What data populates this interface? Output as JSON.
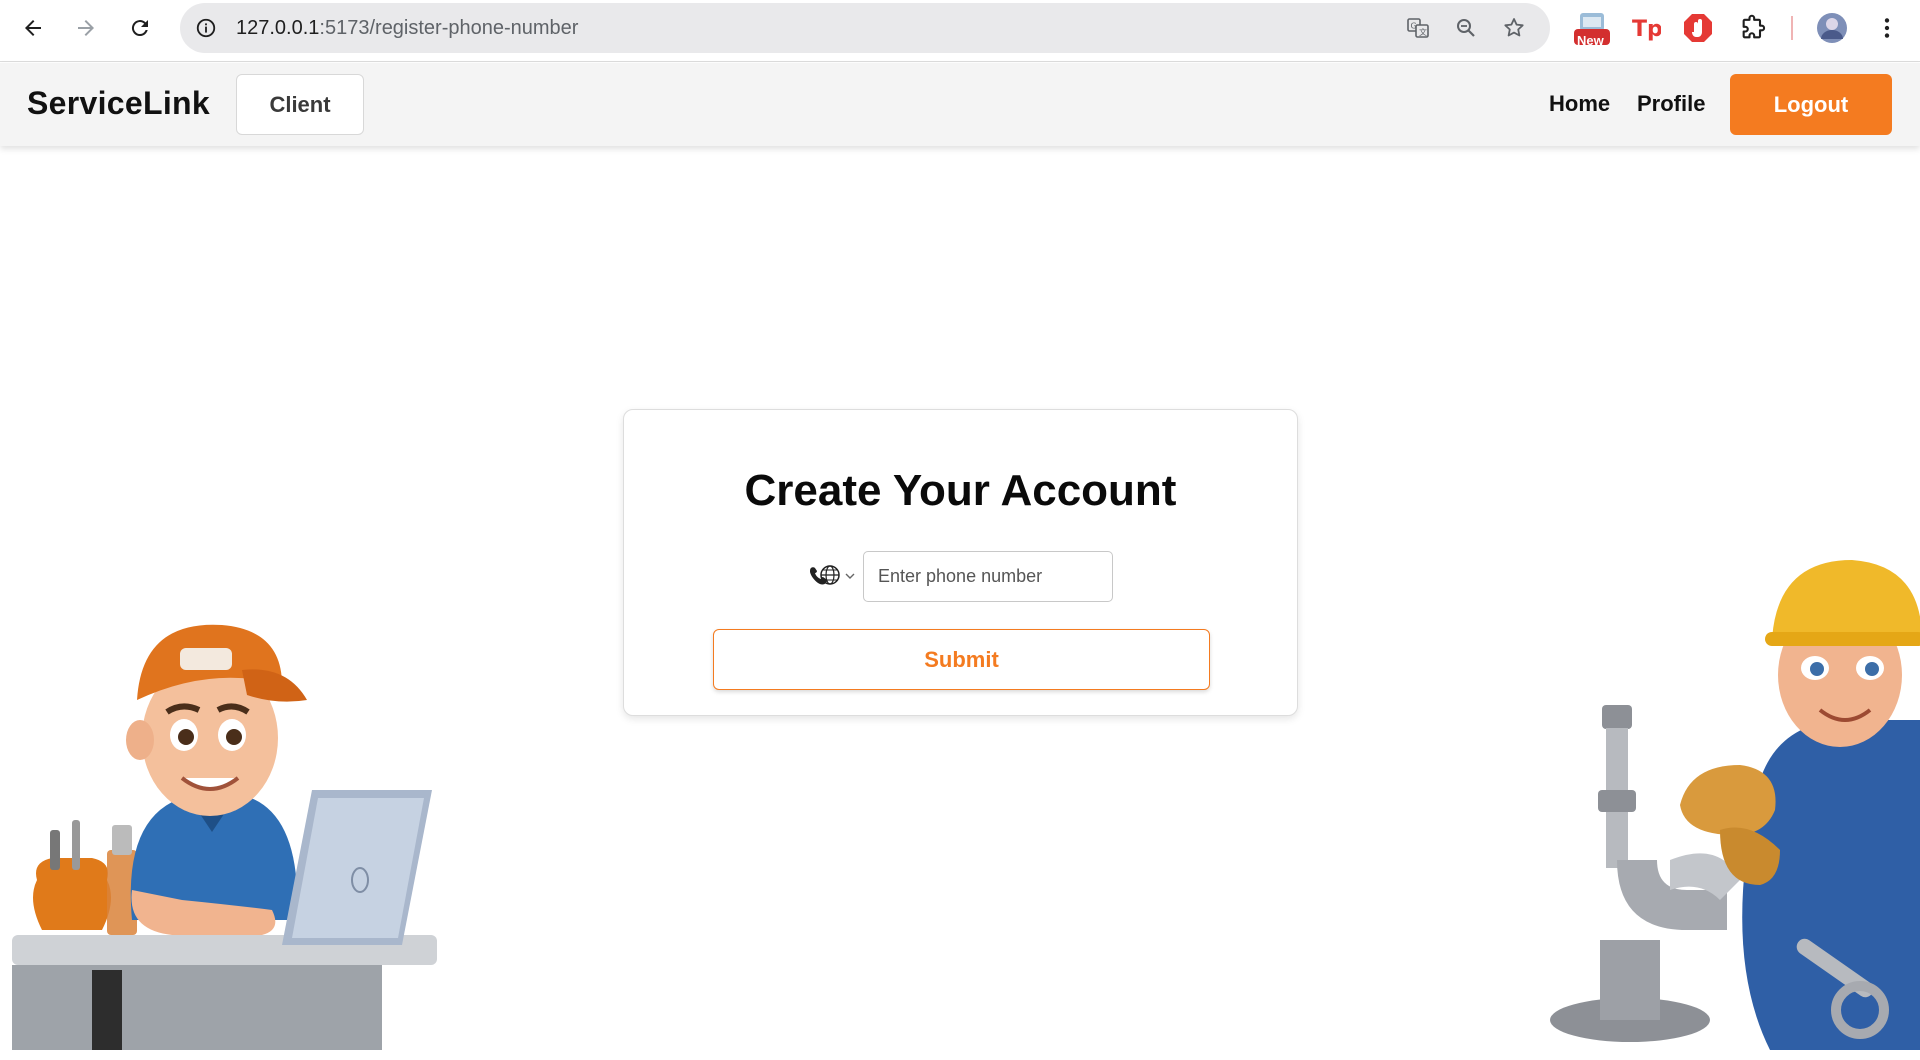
{
  "browser": {
    "url_host": "127.0.0.1",
    "url_path": ":5173/register-phone-number",
    "extension_badge": "New"
  },
  "header": {
    "brand": "ServiceLink",
    "role_button": "Client",
    "nav": {
      "home": "Home",
      "profile": "Profile",
      "logout": "Logout"
    }
  },
  "card": {
    "title": "Create Your Account",
    "phone_placeholder": "Enter phone number",
    "submit_label": "Submit"
  },
  "colors": {
    "accent": "#f47b20",
    "header_bg": "#f4f4f4"
  }
}
